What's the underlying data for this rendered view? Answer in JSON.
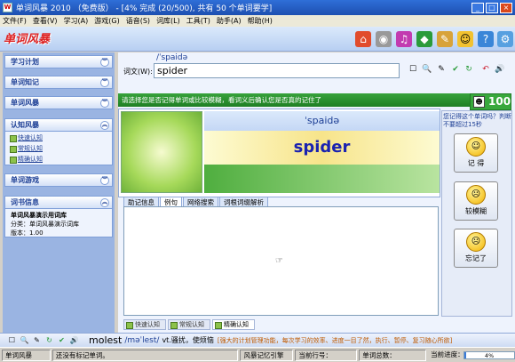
{
  "window": {
    "title": "单词风暴 2010 （免费版） - [4% 完成 (20/500), 共有 50 个单词要学]"
  },
  "menu": [
    "文件(F)",
    "查看(V)",
    "学习(A)",
    "游戏(G)",
    "语音(S)",
    "词库(L)",
    "工具(T)",
    "助手(A)",
    "帮助(H)"
  ],
  "logo": "单词风暴",
  "sidebar": {
    "sections": [
      {
        "label": "学习计划"
      },
      {
        "label": "单词知记"
      },
      {
        "label": "单词风暴"
      },
      {
        "label": "认知风暴",
        "items": [
          "快速认知",
          "常规认知",
          "精确认知"
        ]
      },
      {
        "label": "单词游戏"
      },
      {
        "label": "词书信息"
      }
    ],
    "bookinfo": {
      "name": "单词风暴演示用词库",
      "category": "分类：单词风暴演示词库",
      "version": "版本：1.00"
    }
  },
  "word_field": {
    "label": "词文(W):",
    "value": "spider",
    "phonetic": "/ˈspaidə"
  },
  "banner": "请选择您是否记得单词或比较模糊，看词义后确认您是否真的记住了",
  "score": {
    "value": "100"
  },
  "card": {
    "phonetic": "ˈspaidə",
    "word": "spider"
  },
  "tabs": [
    "助记信息",
    "例句",
    "网络搜索",
    "词根词缀解析"
  ],
  "modes": [
    "快速认知",
    "常规认知",
    "精确认知"
  ],
  "right": {
    "question": "您记得这个单词吗？判断不要超过15秒",
    "buttons": [
      "记  得",
      "较模糊",
      "忘记了"
    ]
  },
  "bottom": {
    "word": "molest",
    "phonetic": "/məˈlest/",
    "meaning": "vt.骚扰，使烦恼",
    "hint": "[强大的计划管理功能，每次学习的效率、进度一目了然，执行、暂停、复习随心所欲]"
  },
  "status": {
    "app": "单词风暴",
    "no_history": "还没有标记单词。",
    "engine": "风暴记忆引擎",
    "current_row": "当前行号：",
    "total_words": "单词总数：",
    "progress_label": "当前进度：",
    "progress_text": "4%",
    "progress_value": 0.04
  }
}
